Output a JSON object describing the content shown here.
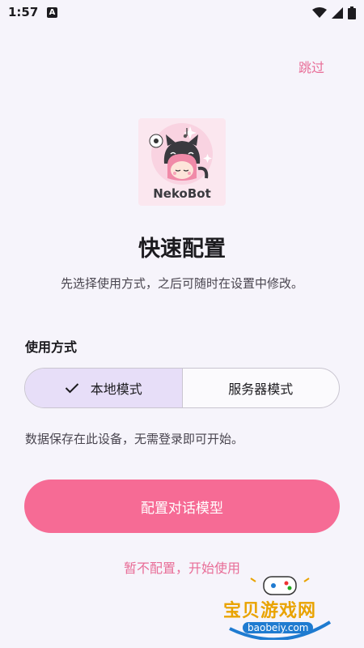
{
  "status_bar": {
    "time": "1:57",
    "app_badge": "A"
  },
  "header": {
    "skip_label": "跳过"
  },
  "logo": {
    "brand_text": "NekoBot"
  },
  "main": {
    "title": "快速配置",
    "subtitle": "先选择使用方式，之后可随时在设置中修改。",
    "mode_label": "使用方式",
    "modes": [
      {
        "label": "本地模式",
        "selected": true
      },
      {
        "label": "服务器模式",
        "selected": false
      }
    ],
    "mode_hint": "数据保存在此设备，无需登录即可开始。",
    "primary_button": "配置对话模型",
    "secondary_link": "暂不配置，开始使用"
  },
  "watermark": {
    "text": "宝贝游戏网",
    "url": "baobeiy.com"
  },
  "colors": {
    "accent": "#f66b95",
    "link": "#e86d97",
    "selected_segment": "#e7def8",
    "background": "#f6f4fb"
  },
  "icons": [
    "wifi-icon",
    "cellular-icon",
    "battery-icon",
    "check-icon"
  ]
}
